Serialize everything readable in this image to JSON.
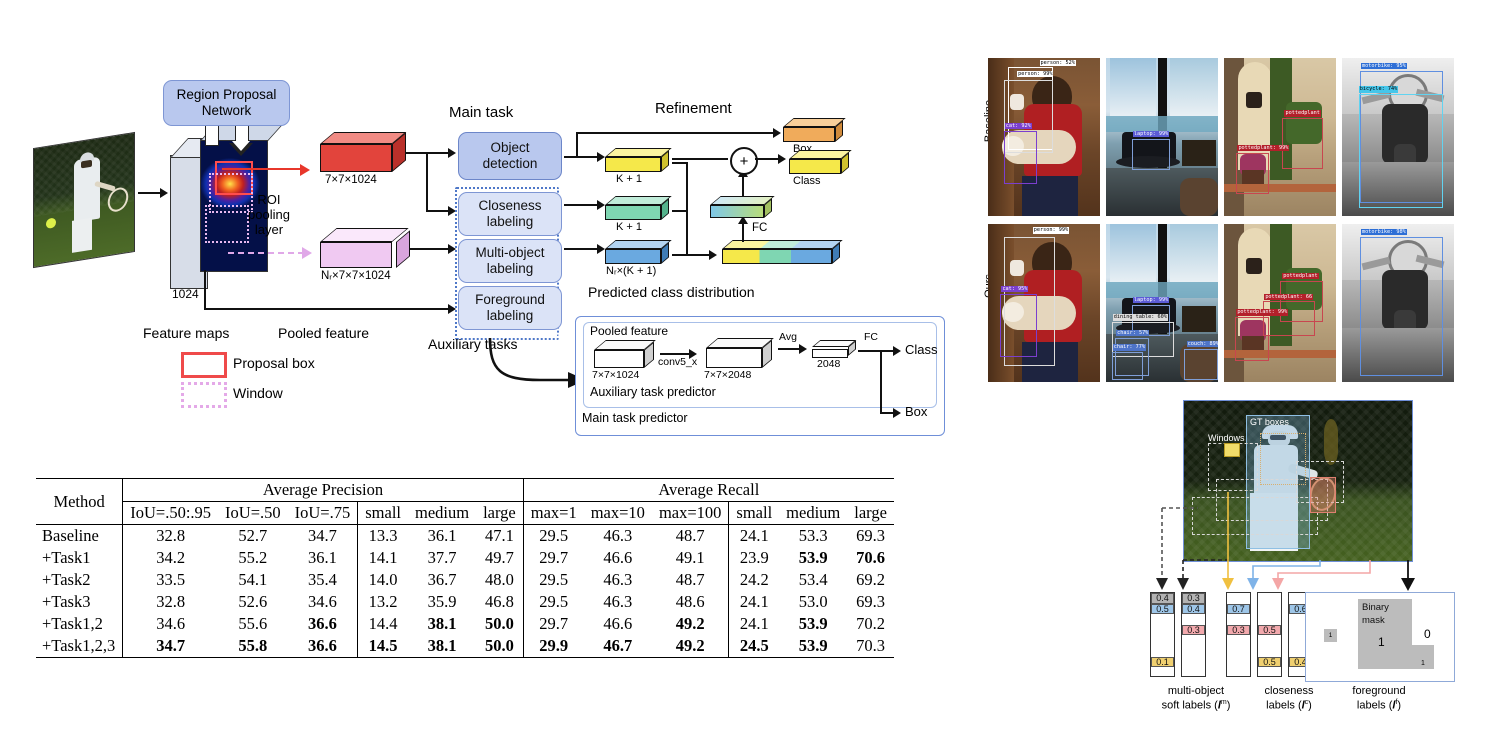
{
  "figure": {
    "left_diagram": {
      "rpn_label": "Region Proposal\nNetwork",
      "rpn_line1": "Region Proposal",
      "rpn_line2": "Network",
      "input_caption": "1024",
      "feature_maps_label": "Feature maps",
      "pooled_feature_label": "Pooled feature",
      "roi_label_l1": "ROI",
      "roi_label_l2": "pooling",
      "roi_label_l3": "layer",
      "red_slab_caption": "7×7×1024",
      "pink_slab_caption": "Nᵣ×7×7×1024",
      "main_task_header": "Main task",
      "auxiliary_tasks_header": "Auxiliary tasks",
      "tasks": [
        {
          "id": "object-detection",
          "line1": "Object",
          "line2": "detection",
          "kind": "main"
        },
        {
          "id": "closeness-labeling",
          "line1": "Closeness",
          "line2": "labeling",
          "kind": "aux"
        },
        {
          "id": "multi-object-labeling",
          "line1": "Multi-object",
          "line2": "labeling",
          "kind": "aux"
        },
        {
          "id": "foreground-labeling",
          "line1": "Foreground",
          "line2": "labeling",
          "kind": "aux"
        }
      ],
      "legend": [
        {
          "id": "proposal-box",
          "label": "Proposal box",
          "color": "#ef4a4a",
          "style": "solid"
        },
        {
          "id": "window",
          "label": "Window",
          "color": "#e4a9e8",
          "style": "dotted"
        }
      ]
    },
    "refinement": {
      "header": "Refinement",
      "box_label": "Box",
      "class_label": "Class",
      "plus_symbol": "+",
      "fc_label": "FC",
      "yellow_caption": "K + 1",
      "green_caption": "K + 1",
      "blue_caption": "Nᵣ×(K + 1)",
      "distribution_caption": "Predicted class distribution"
    },
    "predictor": {
      "outer_label": "Main task predictor",
      "inner_label": "Auxiliary task predictor",
      "pooled_feature_label": "Pooled feature",
      "slab1_caption": "7×7×1024",
      "slab2_caption": "7×7×2048",
      "slab3_caption": "2048",
      "conv_label": "conv5_x",
      "avg_label": "Avg",
      "fc_label": "FC",
      "class_label": "Class",
      "box_label": "Box"
    },
    "qualitative": {
      "row_labels": [
        "Baseline",
        "Ours"
      ],
      "rows": [
        {
          "name": "Baseline",
          "images": [
            {
              "id": "boy-cat",
              "detections": [
                {
                  "text": "person: 52%",
                  "color": "#ffffff",
                  "textcolor": "#000000",
                  "x": 46,
                  "y": 1,
                  "bx": 18,
                  "by": 6,
                  "bw": 40,
                  "bh": 52,
                  "bc": "#ffffff"
                },
                {
                  "text": "person: 99%",
                  "color": "#ffffff",
                  "textcolor": "#000000",
                  "x": 26,
                  "y": 8,
                  "bx": 14,
                  "by": 14,
                  "bw": 44,
                  "bh": 46,
                  "bc": "#dddddd"
                },
                {
                  "text": "cat: 92%",
                  "color": "#7b3fcf",
                  "textcolor": "#ffffff",
                  "x": 15,
                  "y": 41,
                  "bx": 14,
                  "by": 46,
                  "bw": 30,
                  "bh": 34,
                  "bc": "#7b3fcf"
                }
              ]
            },
            {
              "id": "laptop-table",
              "detections": [
                {
                  "text": "laptop: 99%",
                  "color": "#5b5bd6",
                  "textcolor": "#ffffff",
                  "x": 24,
                  "y": 46,
                  "bx": 23,
                  "by": 51,
                  "bw": 34,
                  "bh": 20,
                  "bc": "#7f9fd8"
                }
              ]
            },
            {
              "id": "pottedplant",
              "detections": [
                {
                  "text": "pottedplant",
                  "color": "#b3202a",
                  "textcolor": "#ffffff",
                  "x": 54,
                  "y": 33,
                  "bx": 52,
                  "by": 38,
                  "bw": 36,
                  "bh": 32,
                  "bc": "#c8464f"
                },
                {
                  "text": "pottedplant: 99%",
                  "color": "#b3202a",
                  "textcolor": "#ffffff",
                  "x": 12,
                  "y": 55,
                  "bx": 11,
                  "by": 60,
                  "bw": 29,
                  "bh": 26,
                  "bc": "#c8464f"
                }
              ]
            },
            {
              "id": "motorbike",
              "detections": [
                {
                  "text": "motorbike: 95%",
                  "color": "#2e6fd6",
                  "textcolor": "#ffffff",
                  "x": 17,
                  "y": 3,
                  "bx": 16,
                  "by": 8,
                  "bw": 74,
                  "bh": 84,
                  "bc": "#5f8fe0"
                },
                {
                  "text": "bicycle: 74%",
                  "color": "#45c6ea",
                  "textcolor": "#000000",
                  "x": 15,
                  "y": 18,
                  "bx": 15,
                  "by": 23,
                  "bw": 75,
                  "bh": 72,
                  "bc": "#61d3f0"
                }
              ]
            }
          ]
        },
        {
          "name": "Ours",
          "images": [
            {
              "id": "boy-cat",
              "detections": [
                {
                  "text": "person: 99%",
                  "color": "#ffffff",
                  "textcolor": "#000000",
                  "x": 40,
                  "y": 2,
                  "bx": 14,
                  "by": 8,
                  "bw": 46,
                  "bh": 82,
                  "bc": "#dddddd"
                },
                {
                  "text": "cat: 95%",
                  "color": "#7b3fcf",
                  "textcolor": "#ffffff",
                  "x": 12,
                  "y": 39,
                  "bx": 11,
                  "by": 44,
                  "bw": 33,
                  "bh": 40,
                  "bc": "#7b3fcf"
                }
              ]
            },
            {
              "id": "laptop-table",
              "detections": [
                {
                  "text": "laptop: 99%",
                  "color": "#5b5bd6",
                  "textcolor": "#ffffff",
                  "x": 24,
                  "y": 46,
                  "bx": 23,
                  "by": 51,
                  "bw": 34,
                  "bh": 20,
                  "bc": "#7f9fd8"
                },
                {
                  "text": "dining table: 60%",
                  "color": "#dddddd",
                  "textcolor": "#000000",
                  "x": 6,
                  "y": 57,
                  "bx": 5,
                  "by": 62,
                  "bw": 56,
                  "bh": 22,
                  "bc": "#dddddd"
                },
                {
                  "text": "chair: 57%",
                  "color": "#4e74c8",
                  "textcolor": "#ffffff",
                  "x": 9,
                  "y": 67,
                  "bx": 8,
                  "by": 72,
                  "bw": 30,
                  "bh": 24,
                  "bc": "#7f9fd8"
                },
                {
                  "text": "chair: 77%",
                  "color": "#4e74c8",
                  "textcolor": "#ffffff",
                  "x": 6,
                  "y": 76,
                  "bx": 5,
                  "by": 81,
                  "bw": 28,
                  "bh": 18,
                  "bc": "#7f9fd8"
                },
                {
                  "text": "couch: 89%",
                  "color": "#4e74c8",
                  "textcolor": "#ffffff",
                  "x": 72,
                  "y": 74,
                  "bx": 70,
                  "by": 79,
                  "bw": 30,
                  "bh": 20,
                  "bc": "#7f9fd8"
                }
              ]
            },
            {
              "id": "pottedplant",
              "detections": [
                {
                  "text": "pottedplant",
                  "color": "#b3202a",
                  "textcolor": "#ffffff",
                  "x": 52,
                  "y": 31,
                  "bx": 50,
                  "by": 36,
                  "bw": 38,
                  "bh": 26,
                  "bc": "#c8464f"
                },
                {
                  "text": "pottedplant: 66",
                  "color": "#b3202a",
                  "textcolor": "#ffffff",
                  "x": 36,
                  "y": 44,
                  "bx": 35,
                  "by": 49,
                  "bw": 46,
                  "bh": 22,
                  "bc": "#c8464f"
                },
                {
                  "text": "pottedplant: 99%",
                  "color": "#b3202a",
                  "textcolor": "#ffffff",
                  "x": 11,
                  "y": 54,
                  "bx": 10,
                  "by": 59,
                  "bw": 30,
                  "bh": 28,
                  "bc": "#c8464f"
                }
              ]
            },
            {
              "id": "motorbike",
              "detections": [
                {
                  "text": "motorbike: 98%",
                  "color": "#2e6fd6",
                  "textcolor": "#ffffff",
                  "x": 17,
                  "y": 3,
                  "bx": 16,
                  "by": 8,
                  "bw": 74,
                  "bh": 88,
                  "bc": "#5f8fe0"
                }
              ]
            }
          ]
        }
      ]
    },
    "label_figure": {
      "windows_label": "Windows",
      "gt_boxes_label": "GT boxes",
      "binary_mask_label_l1": "Binary",
      "binary_mask_label_l2": "mask",
      "mask_one": "1",
      "mask_zero": "0",
      "mask_small_one": "1",
      "mask_tiny_one": "1",
      "columns": [
        {
          "id": "col1",
          "arrow_color": "#444444",
          "arrow_dashed": true,
          "cells": [
            {
              "v": "0.4",
              "c": "#b3b3b3",
              "row": 0
            },
            {
              "v": "0.5",
              "c": "#9ec6e8",
              "row": 1
            },
            {
              "v": "0.1",
              "c": "#f0d070",
              "row": 6
            }
          ]
        },
        {
          "id": "col2",
          "arrow_color": "#222222",
          "arrow_dashed": true,
          "cells": [
            {
              "v": "0.3",
              "c": "#b3b3b3",
              "row": 0
            },
            {
              "v": "0.4",
              "c": "#9ec6e8",
              "row": 1
            },
            {
              "v": "0.3",
              "c": "#f2a9ad",
              "row": 3
            }
          ]
        },
        {
          "id": "col3",
          "arrow_color": "#f0c040",
          "arrow_dashed": false,
          "cells": [
            {
              "v": "0.7",
              "c": "#9ec6e8",
              "row": 1
            },
            {
              "v": "0.3",
              "c": "#f2a9ad",
              "row": 3
            }
          ]
        },
        {
          "id": "col4",
          "arrow_color": "#7fb3e8",
          "arrow_dashed": false,
          "cells": [
            {
              "v": "0.5",
              "c": "#f2a9ad",
              "row": 3
            },
            {
              "v": "0.5",
              "c": "#f0d070",
              "row": 6
            }
          ]
        },
        {
          "id": "col5",
          "arrow_color": "#f4a6a6",
          "arrow_dashed": false,
          "cells": [
            {
              "v": "0.6",
              "c": "#9ec6e8",
              "row": 1
            },
            {
              "v": "0.4",
              "c": "#f0d070",
              "row": 6
            }
          ]
        }
      ],
      "captions": [
        {
          "id": "multi-object",
          "l1": "multi-object",
          "l2": "soft labels (𝒍m)",
          "l2_plain": "soft labels (",
          "sym": "l",
          "sup": "m"
        },
        {
          "id": "closeness",
          "l1": "closeness",
          "l2": "labels (𝒍c)",
          "l2_plain": "labels (",
          "sym": "l",
          "sup": "c"
        },
        {
          "id": "foreground",
          "l1": "foreground",
          "l2": "labels (𝒍f)",
          "l2_plain": "labels (",
          "sym": "l",
          "sup": "f"
        }
      ]
    }
  },
  "table": {
    "method_header": "Method",
    "group_headers": [
      "Average Precision",
      "Average Recall"
    ],
    "sub_headers": [
      "IoU=.50:.95",
      "IoU=.50",
      "IoU=.75",
      "small",
      "medium",
      "large",
      "max=1",
      "max=10",
      "max=100",
      "small",
      "medium",
      "large"
    ],
    "rows": [
      {
        "method": "Baseline",
        "values": [
          "32.8",
          "52.7",
          "34.7",
          "13.3",
          "36.1",
          "47.1",
          "29.5",
          "46.3",
          "48.7",
          "24.1",
          "53.3",
          "69.3"
        ],
        "bold": [
          false,
          false,
          false,
          false,
          false,
          false,
          false,
          false,
          false,
          false,
          false,
          false
        ]
      },
      {
        "method": "+Task1",
        "values": [
          "34.2",
          "55.2",
          "36.1",
          "14.1",
          "37.7",
          "49.7",
          "29.7",
          "46.6",
          "49.1",
          "23.9",
          "53.9",
          "70.6"
        ],
        "bold": [
          false,
          false,
          false,
          false,
          false,
          false,
          false,
          false,
          false,
          false,
          true,
          true
        ]
      },
      {
        "method": "+Task2",
        "values": [
          "33.5",
          "54.1",
          "35.4",
          "14.0",
          "36.7",
          "48.0",
          "29.5",
          "46.3",
          "48.7",
          "24.2",
          "53.4",
          "69.2"
        ],
        "bold": [
          false,
          false,
          false,
          false,
          false,
          false,
          false,
          false,
          false,
          false,
          false,
          false
        ]
      },
      {
        "method": "+Task3",
        "values": [
          "32.8",
          "52.6",
          "34.6",
          "13.2",
          "35.9",
          "46.8",
          "29.5",
          "46.3",
          "48.6",
          "24.1",
          "53.0",
          "69.3"
        ],
        "bold": [
          false,
          false,
          false,
          false,
          false,
          false,
          false,
          false,
          false,
          false,
          false,
          false
        ]
      },
      {
        "method": "+Task1,2",
        "values": [
          "34.6",
          "55.6",
          "36.6",
          "14.4",
          "38.1",
          "50.0",
          "29.7",
          "46.6",
          "49.2",
          "24.1",
          "53.9",
          "70.2"
        ],
        "bold": [
          false,
          false,
          true,
          false,
          true,
          true,
          false,
          false,
          true,
          false,
          true,
          false
        ]
      },
      {
        "method": "+Task1,2,3",
        "values": [
          "34.7",
          "55.8",
          "36.6",
          "14.5",
          "38.1",
          "50.0",
          "29.9",
          "46.7",
          "49.2",
          "24.5",
          "53.9",
          "70.3"
        ],
        "bold": [
          true,
          true,
          true,
          true,
          true,
          true,
          true,
          true,
          true,
          true,
          true,
          false
        ]
      }
    ]
  }
}
